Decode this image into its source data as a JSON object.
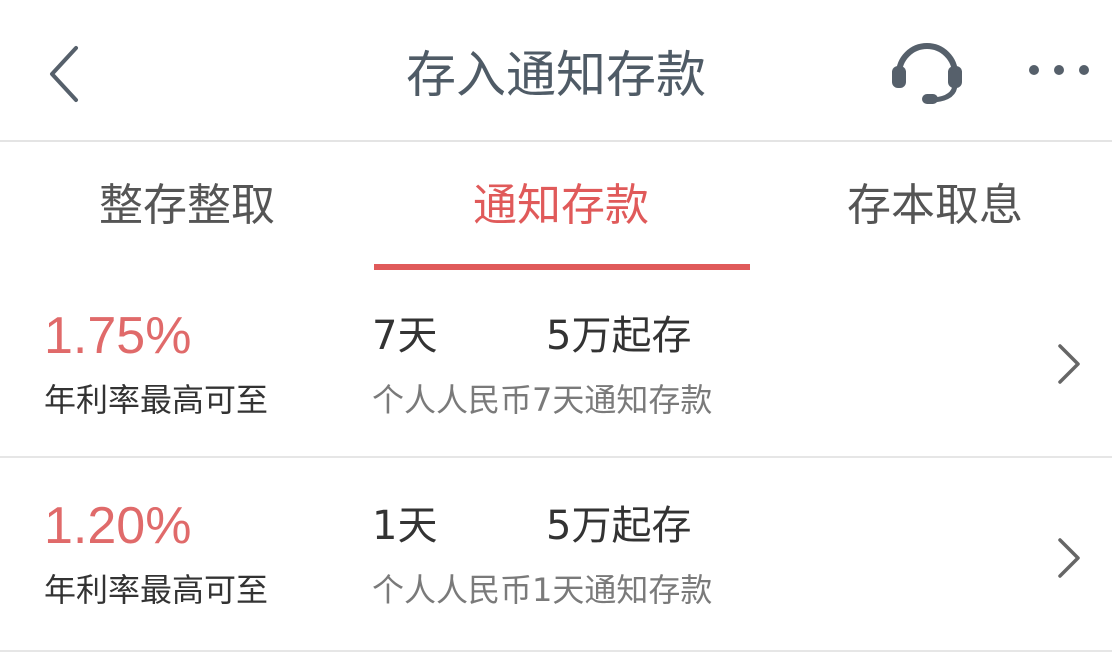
{
  "header": {
    "title": "存入通知存款",
    "back_icon": "chevron-left-icon",
    "service_icon": "headset-icon",
    "more_icon": "more-dots-icon"
  },
  "tabs": [
    {
      "label": "整存整取",
      "active": false
    },
    {
      "label": "通知存款",
      "active": true
    },
    {
      "label": "存本取息",
      "active": false
    }
  ],
  "colors": {
    "accent": "#e05a5a",
    "rate": "#e06a6a",
    "title": "#4f5b66",
    "muted": "#7a7a7a"
  },
  "products": [
    {
      "rate": "1.75%",
      "rate_label": "年利率最高可至",
      "period": "7天",
      "min_deposit": "5万起存",
      "name": "个人人民币7天通知存款"
    },
    {
      "rate": "1.20%",
      "rate_label": "年利率最高可至",
      "period": "1天",
      "min_deposit": "5万起存",
      "name": "个人人民币1天通知存款"
    }
  ]
}
